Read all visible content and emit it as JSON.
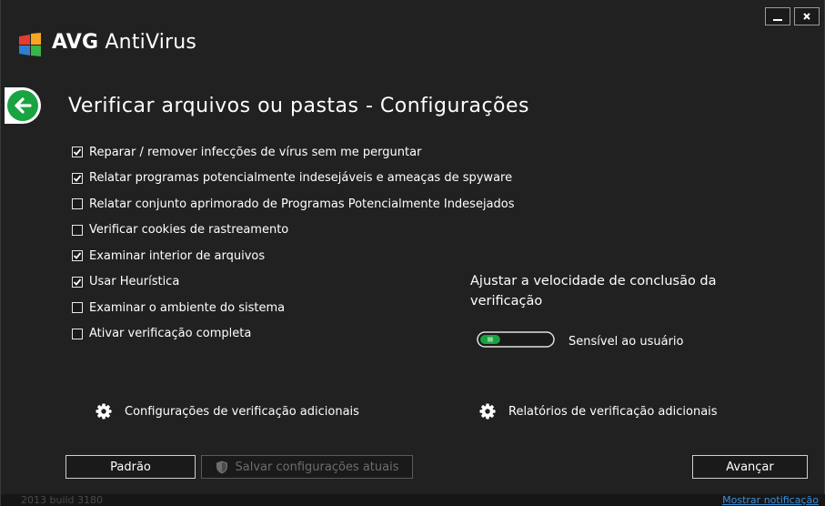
{
  "window": {
    "brand": "AVG",
    "product": "AntiVirus",
    "minimize_label": "—",
    "close_label": "×"
  },
  "page": {
    "title": "Verificar arquivos ou pastas - Configurações"
  },
  "options": [
    {
      "label": "Reparar / remover infecções de vírus sem me perguntar",
      "checked": true
    },
    {
      "label": "Relatar programas potencialmente indesejáveis e ameaças de spyware",
      "checked": true
    },
    {
      "label": "Relatar conjunto aprimorado de Programas Potencialmente Indesejados",
      "checked": false
    },
    {
      "label": "Verificar cookies de rastreamento",
      "checked": false
    },
    {
      "label": "Examinar interior de arquivos",
      "checked": true
    },
    {
      "label": "Usar Heurística",
      "checked": true
    },
    {
      "label": "Examinar o ambiente do sistema",
      "checked": false
    },
    {
      "label": "Ativar verificação completa",
      "checked": false
    }
  ],
  "speed": {
    "title": "Ajustar a velocidade de conclusão da verificação",
    "level_label": "Sensível ao usuário",
    "level_fraction": 0.28
  },
  "links": {
    "additional_settings": "Configurações de verificação adicionais",
    "additional_reports": "Relatórios de verificação adicionais"
  },
  "buttons": {
    "default": "Padrão",
    "save": "Salvar configurações atuais",
    "next": "Avançar"
  },
  "footer": {
    "build": "2013 build 3180",
    "notification": "Mostrar notificação"
  },
  "colors": {
    "background": "#212121",
    "accent_green": "#1aa341",
    "link_blue": "#3c8fd6"
  }
}
